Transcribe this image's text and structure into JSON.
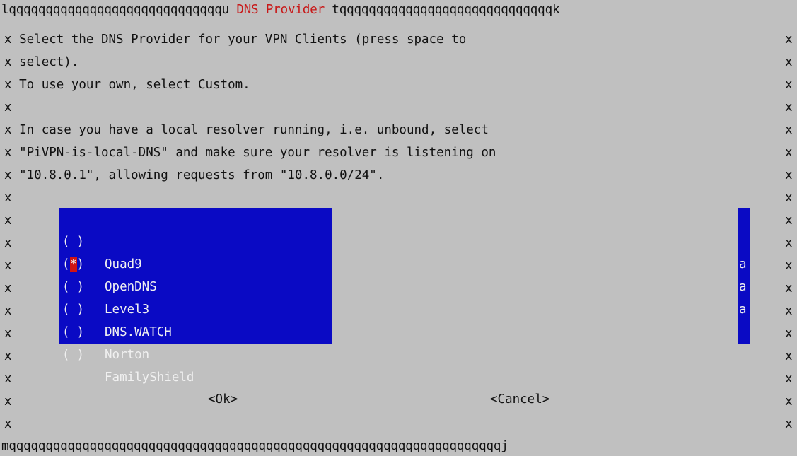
{
  "dialog": {
    "top_border_left": "lqqqqqqqqqqqqqqqqqqqqqqqqqqqqqu",
    "title": " DNS Provider ",
    "top_border_right": "tqqqqqqqqqqqqqqqqqqqqqqqqqqqqqk",
    "bottom_border": "mqqqqqqqqqqqqqqqqqqqqqqqqqqqqqqqqqqqqqqqqqqqqqqqqqqqqqqqqqqqqqqqqqqqj",
    "side_char": "x",
    "message_lines": [
      "Select the DNS Provider for your VPN Clients (press space to",
      "select).",
      "To use your own, select Custom.",
      "",
      "In case you have a local resolver running, i.e. unbound, select",
      "\"PiVPN-is-local-DNS\" and make sure your resolver is listening on",
      "\"10.8.0.1\", allowing requests from \"10.8.0.0/24\"."
    ],
    "options": [
      {
        "label": "Quad9",
        "selected": false
      },
      {
        "label": "OpenDNS",
        "selected": true
      },
      {
        "label": "Level3",
        "selected": false
      },
      {
        "label": "DNS.WATCH",
        "selected": false
      },
      {
        "label": "Norton",
        "selected": false
      },
      {
        "label": "FamilyShield",
        "selected": false
      }
    ],
    "scroll_marks": [
      "",
      "",
      "a",
      "a",
      "a",
      ""
    ],
    "radio_open": "(",
    "radio_close": ")",
    "radio_selected": "*",
    "ok_button": "<Ok>",
    "cancel_button": "<Cancel>"
  },
  "colors": {
    "background": "#c0c0c0",
    "title": "#c81818",
    "list_background": "#0a0ac4",
    "list_text": "#f0f0f0",
    "selected_marker": "#d01414"
  }
}
